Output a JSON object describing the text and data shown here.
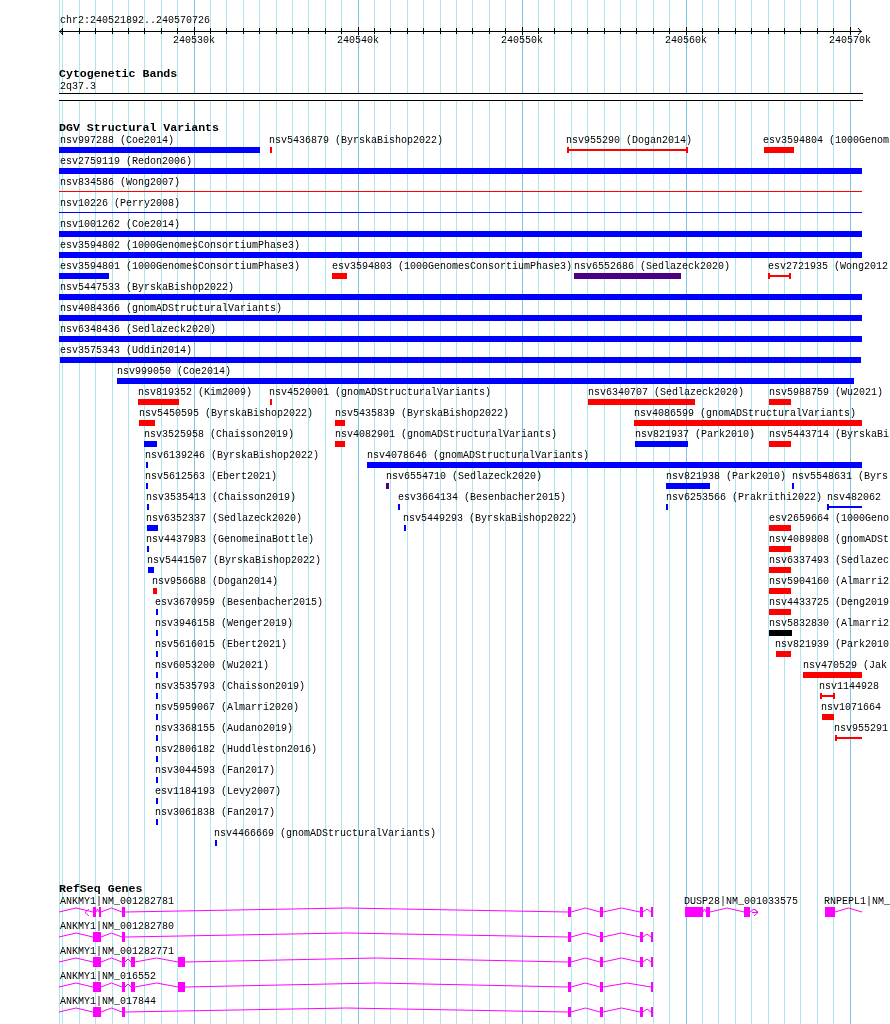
{
  "ruler": {
    "location": "chr2:240521892..240570726",
    "ticks": [
      "240530k",
      "240540k",
      "240550k",
      "240560k",
      "240570k"
    ]
  },
  "cytogenetic_bands": {
    "title": "Cytogenetic Bands",
    "band": "2q37.3"
  },
  "dgv": {
    "title": "DGV Structural Variants",
    "rows": [
      [
        {
          "label": "nsv997288 (Coe2014)",
          "color": "#0000ff",
          "kind": "box"
        },
        {
          "label": "nsv5436879 (ByrskaBishop2022)",
          "color": "#ff0000",
          "kind": "box"
        },
        {
          "label": "nsv955290 (Dogan2014)",
          "color": "#ff0000",
          "kind": "span"
        },
        {
          "label": "esv3594804 (1000Genom",
          "color": "#ff0000",
          "kind": "box"
        }
      ],
      [
        {
          "label": "esv2759119 (Redon2006)",
          "color": "#0000ff",
          "kind": "box"
        }
      ],
      [
        {
          "label": "nsv834586 (Wong2007)",
          "color": "#ff0000",
          "kind": "line"
        }
      ],
      [
        {
          "label": "nsv10226 (Perry2008)",
          "color": "#0000ff",
          "kind": "line"
        }
      ],
      [
        {
          "label": "nsv1001262 (Coe2014)",
          "color": "#0000ff",
          "kind": "box"
        }
      ],
      [
        {
          "label": "esv3594802 (1000GenomesConsortiumPhase3)",
          "color": "#0000ff",
          "kind": "box"
        }
      ],
      [
        {
          "label": "esv3594801 (1000GenomesConsortiumPhase3)",
          "color": "#0000ff",
          "kind": "box"
        },
        {
          "label": "esv3594803 (1000GenomesConsortiumPhase3)",
          "color": "#ff0000",
          "kind": "box"
        },
        {
          "label": "nsv6552686 (Sedlazeck2020)",
          "color": "#4b0082",
          "kind": "box"
        },
        {
          "label": "esv2721935 (Wong2012",
          "color": "#ff0000",
          "kind": "span"
        }
      ],
      [
        {
          "label": "nsv5447533 (ByrskaBishop2022)",
          "color": "#0000ff",
          "kind": "box"
        }
      ],
      [
        {
          "label": "nsv4084366 (gnomADStructuralVariants)",
          "color": "#0000ff",
          "kind": "box"
        }
      ],
      [
        {
          "label": "nsv6348436 (Sedlazeck2020)",
          "color": "#0000ff",
          "kind": "box"
        }
      ],
      [
        {
          "label": "esv3575343 (Uddin2014)",
          "color": "#0000ff",
          "kind": "box"
        }
      ],
      [
        {
          "label": "nsv999050 (Coe2014)",
          "color": "#0000ff",
          "kind": "box"
        }
      ],
      [
        {
          "label": "nsv819352 (Kim2009)",
          "color": "#ff0000",
          "kind": "box"
        },
        {
          "label": "nsv4520001 (gnomADStructuralVariants)",
          "color": "#ff0000",
          "kind": "box"
        },
        {
          "label": "nsv6340707 (Sedlazeck2020)",
          "color": "#ff0000",
          "kind": "box"
        },
        {
          "label": "nsv5988759 (Wu2021)",
          "color": "#ff0000",
          "kind": "box"
        }
      ],
      [
        {
          "label": "nsv5450595 (ByrskaBishop2022)",
          "color": "#ff0000",
          "kind": "box"
        },
        {
          "label": "nsv5435839 (ByrskaBishop2022)",
          "color": "#ff0000",
          "kind": "box"
        },
        {
          "label": "nsv4086599 (gnomADStructuralVariants)",
          "color": "#ff0000",
          "kind": "box"
        }
      ],
      [
        {
          "label": "nsv3525958 (Chaisson2019)",
          "color": "#0000ff",
          "kind": "box"
        },
        {
          "label": "nsv4082901 (gnomADStructuralVariants)",
          "color": "#ff0000",
          "kind": "box"
        },
        {
          "label": "nsv821937 (Park2010)",
          "color": "#0000ff",
          "kind": "box"
        },
        {
          "label": "nsv5443714 (ByrskaBi",
          "color": "#ff0000",
          "kind": "box"
        }
      ],
      [
        {
          "label": "nsv6139246 (ByrskaBishop2022)",
          "color": "#0000ff",
          "kind": "box"
        },
        {
          "label": "nsv4078646 (gnomADStructuralVariants)",
          "color": "#0000ff",
          "kind": "box"
        }
      ],
      [
        {
          "label": "nsv5612563 (Ebert2021)",
          "color": "#0000ff",
          "kind": "box"
        },
        {
          "label": "nsv6554710 (Sedlazeck2020)",
          "color": "#4b0082",
          "kind": "box"
        },
        {
          "label": "nsv821938 (Park2010)",
          "color": "#0000ff",
          "kind": "box"
        },
        {
          "label": "nsv5548631 (Byrs",
          "color": "#0000ff",
          "kind": "box"
        }
      ],
      [
        {
          "label": "nsv3535413 (Chaisson2019)",
          "color": "#0000ff",
          "kind": "box"
        },
        {
          "label": "esv3664134 (Besenbacher2015)",
          "color": "#0000ff",
          "kind": "box"
        },
        {
          "label": "nsv6253566 (Prakrithi2022)",
          "color": "#0000ff",
          "kind": "box"
        },
        {
          "label": "nsv482062",
          "color": "#0000ff",
          "kind": "span"
        }
      ],
      [
        {
          "label": "nsv6352337 (Sedlazeck2020)",
          "color": "#0000ff",
          "kind": "box"
        },
        {
          "label": "nsv5449293 (ByrskaBishop2022)",
          "color": "#0000ff",
          "kind": "box"
        },
        {
          "label": "esv2659664 (1000Geno",
          "color": "#ff0000",
          "kind": "box"
        }
      ],
      [
        {
          "label": "nsv4437983 (GenomeinaBottle)",
          "color": "#0000ff",
          "kind": "box"
        },
        {
          "label": "nsv4089808 (gnomADSt",
          "color": "#ff0000",
          "kind": "box"
        }
      ],
      [
        {
          "label": "nsv5441507 (ByrskaBishop2022)",
          "color": "#0000ff",
          "kind": "box"
        },
        {
          "label": "nsv6337493 (Sedlazec",
          "color": "#ff0000",
          "kind": "box"
        }
      ],
      [
        {
          "label": "nsv956688 (Dogan2014)",
          "color": "#ff0000",
          "kind": "box"
        },
        {
          "label": "nsv5904160 (Almarri2",
          "color": "#ff0000",
          "kind": "box"
        }
      ],
      [
        {
          "label": "esv3670959 (Besenbacher2015)",
          "color": "#0000ff",
          "kind": "box"
        },
        {
          "label": "nsv4433725 (Deng2019",
          "color": "#ff0000",
          "kind": "box"
        }
      ],
      [
        {
          "label": "nsv3946158 (Wenger2019)",
          "color": "#0000ff",
          "kind": "box"
        },
        {
          "label": "nsv5832830 (Almarri2",
          "color": "#000000",
          "kind": "box"
        }
      ],
      [
        {
          "label": "nsv5616015 (Ebert2021)",
          "color": "#0000ff",
          "kind": "box"
        },
        {
          "label": "nsv821939 (Park2010",
          "color": "#ff0000",
          "kind": "box"
        }
      ],
      [
        {
          "label": "nsv6053200 (Wu2021)",
          "color": "#0000ff",
          "kind": "box"
        },
        {
          "label": "nsv470529 (Jak",
          "color": "#ff0000",
          "kind": "box"
        }
      ],
      [
        {
          "label": "nsv3535793 (Chaisson2019)",
          "color": "#0000ff",
          "kind": "box"
        },
        {
          "label": "nsv1144928",
          "color": "#ff0000",
          "kind": "span"
        }
      ],
      [
        {
          "label": "nsv5959067 (Almarri2020)",
          "color": "#0000ff",
          "kind": "box"
        },
        {
          "label": "nsv1071664",
          "color": "#ff0000",
          "kind": "box"
        }
      ],
      [
        {
          "label": "nsv3368155 (Audano2019)",
          "color": "#0000ff",
          "kind": "box"
        },
        {
          "label": "nsv955291",
          "color": "#ff0000",
          "kind": "span"
        }
      ],
      [
        {
          "label": "nsv2806182 (Huddleston2016)",
          "color": "#0000ff",
          "kind": "box"
        }
      ],
      [
        {
          "label": "nsv3044593 (Fan2017)",
          "color": "#0000ff",
          "kind": "box"
        }
      ],
      [
        {
          "label": "esv1184193 (Levy2007)",
          "color": "#0000ff",
          "kind": "box"
        }
      ],
      [
        {
          "label": "nsv3061838 (Fan2017)",
          "color": "#0000ff",
          "kind": "box"
        }
      ],
      [
        {
          "label": "nsv4466669 (gnomADStructuralVariants)",
          "color": "#0000ff",
          "kind": "box"
        }
      ]
    ]
  },
  "refseq": {
    "title": "RefSeq Genes",
    "rows": [
      [
        {
          "label": "ANKMY1|NM_001282781",
          "arrow_left": true
        },
        {
          "label": "DUSP28|NM_001033575",
          "arrow_right": true
        },
        {
          "label": "RNPEPL1|NM_"
        }
      ],
      [
        {
          "label": "ANKMY1|NM_001282780"
        }
      ],
      [
        {
          "label": "ANKMY1|NM_001282771"
        }
      ],
      [
        {
          "label": "ANKMY1|NM_016552"
        }
      ],
      [
        {
          "label": "ANKMY1|NM_017844"
        }
      ]
    ]
  }
}
